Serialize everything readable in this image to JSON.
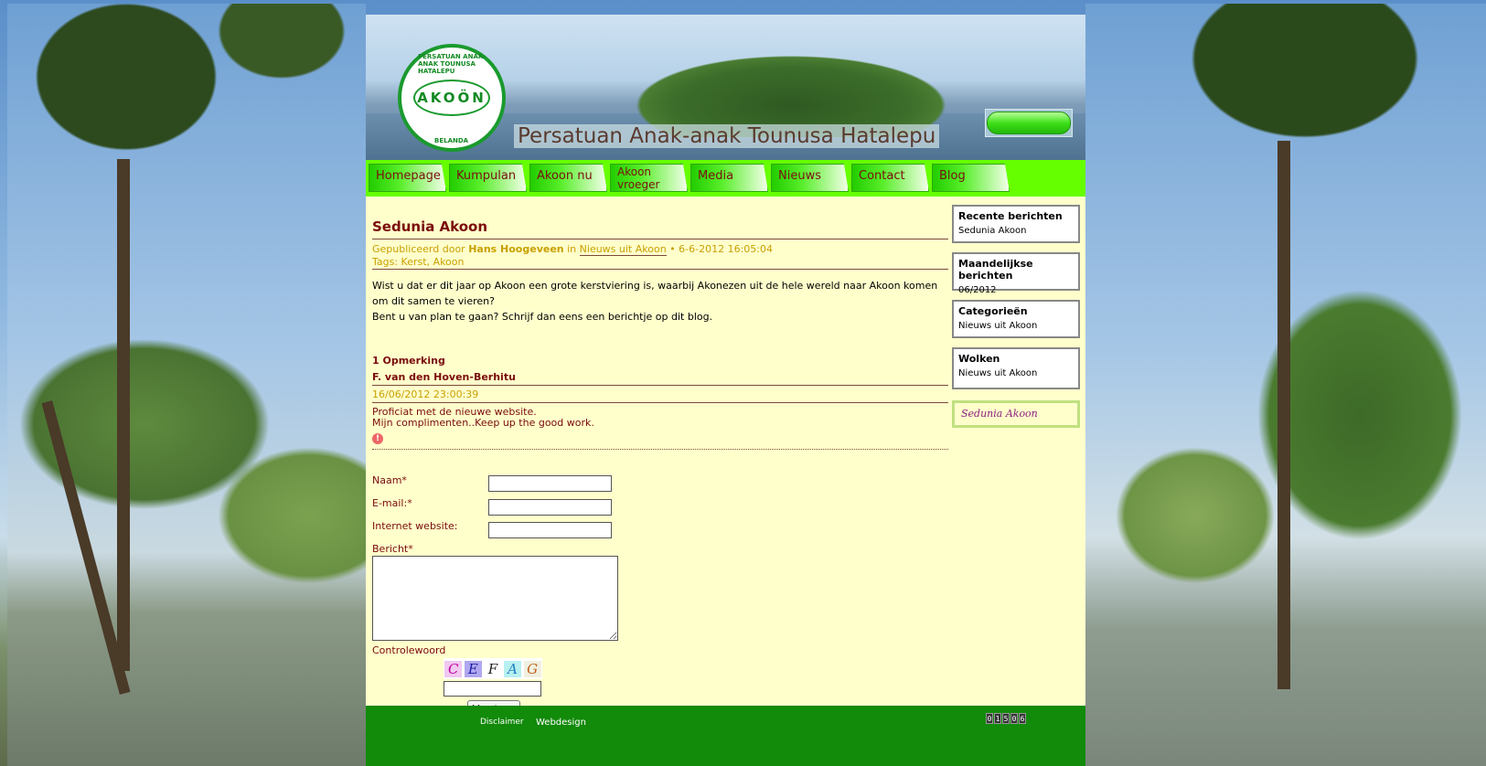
{
  "header": {
    "logo_text": "AKOÖN",
    "logo_ring_top": "PERSATUAN ANAK-ANAK TOUNUSA HATALEPU",
    "logo_ring_bottom": "BELANDA",
    "site_title": "Persatuan Anak-anak Tounusa Hatalepu"
  },
  "nav": {
    "items": [
      {
        "label": "Homepage"
      },
      {
        "label": "Kumpulan"
      },
      {
        "label": "Akoon nu"
      },
      {
        "label": "Akoon vroeger"
      },
      {
        "label": "Media"
      },
      {
        "label": "Nieuws"
      },
      {
        "label": "Contact"
      },
      {
        "label": "Blog"
      }
    ]
  },
  "post": {
    "title": "Sedunia Akoon",
    "published_by": "Gepubliceerd door",
    "author": "Hans Hoogeveen",
    "in_label": "in",
    "category": "Nieuws uit Akoon",
    "date": "• 6-6-2012 16:05:04",
    "tags": "Tags: Kerst, Akoon",
    "body_1": "Wist u dat er dit jaar op Akoon een grote kerstviering is, waarbij Akonezen uit de hele wereld naar Akoon komen om dit samen te vieren?",
    "body_2": "Bent u van plan te gaan? Schrijf dan eens een berichtje op dit blog."
  },
  "comments": {
    "count_label": "1 Opmerking",
    "items": [
      {
        "author": "F. van den Hoven-Berhitu",
        "date": "16/06/2012 23:00:39",
        "line_1": "Proficiat met de nieuwe website.",
        "line_2": "Mijn complimenten..Keep up the good work."
      }
    ]
  },
  "form": {
    "name_label": "Naam*",
    "email_label": "E-mail:*",
    "website_label": "Internet website:",
    "message_label": "Bericht*",
    "captcha_label": "Controlewoord",
    "captcha_chars": [
      "C",
      "E",
      "F",
      "A",
      "G"
    ],
    "submit_label": "Verstuur"
  },
  "sidebar": {
    "recent_title": "Recente berichten",
    "recent_item": "Sedunia Akoon",
    "monthly_title": "Maandelijkse berichten",
    "monthly_item": "06/2012",
    "categories_title": "Categorieën",
    "categories_item": "Nieuws uit Akoon",
    "clouds_title": "Wolken",
    "clouds_item": "Nieuws uit Akoon",
    "highlight": "Sedunia Akoon"
  },
  "footer": {
    "disclaimer": "Disclaimer",
    "webdesign": "Webdesign",
    "counter_digits": [
      "0",
      "1",
      "5",
      "0",
      "6"
    ]
  },
  "colors": {
    "nav_bg": "#66ff00",
    "page_bg": "#ffffcc",
    "footer_bg": "#128a0a",
    "title_color": "#7a0a0a",
    "meta_color": "#c8a000"
  }
}
